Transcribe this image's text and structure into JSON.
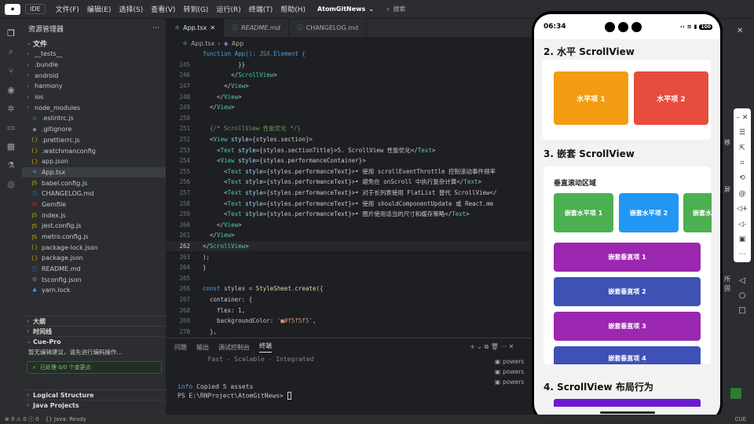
{
  "titlebar": {
    "ide": "IDE",
    "menus": [
      "文件(F)",
      "编辑(E)",
      "选择(S)",
      "查看(V)",
      "转到(G)",
      "运行(R)",
      "终端(T)",
      "帮助(H)"
    ],
    "project": "AtomGitNews",
    "search": "搜索"
  },
  "explorer": {
    "title": "资源管理器",
    "root": "文件",
    "items": [
      {
        "name": "__tests__",
        "type": "folder"
      },
      {
        "name": ".bundle",
        "type": "folder"
      },
      {
        "name": "android",
        "type": "folder"
      },
      {
        "name": "harmony",
        "type": "folder"
      },
      {
        "name": "ios",
        "type": "folder"
      },
      {
        "name": "node_modules",
        "type": "folder"
      },
      {
        "name": ".eslintrc.js",
        "type": "file",
        "icon": "⊙",
        "color": "#4b7bec"
      },
      {
        "name": ".gitignore",
        "type": "file",
        "icon": "◆",
        "color": "#888"
      },
      {
        "name": ".prettierrc.js",
        "type": "file",
        "icon": "{}",
        "color": "#c8a000"
      },
      {
        "name": ".watchmanconfig",
        "type": "file",
        "icon": "{}",
        "color": "#c8a000"
      },
      {
        "name": "app.json",
        "type": "file",
        "icon": "{}",
        "color": "#c8a000"
      },
      {
        "name": "App.tsx",
        "type": "file",
        "icon": "⚛",
        "color": "#5fb0e0",
        "sel": true
      },
      {
        "name": "babel.config.js",
        "type": "file",
        "icon": "JS",
        "color": "#c8b000"
      },
      {
        "name": "CHANGELOG.md",
        "type": "file",
        "icon": "ⓘ",
        "color": "#4b9bec"
      },
      {
        "name": "Gemfile",
        "type": "file",
        "icon": "▤",
        "color": "#aa3333"
      },
      {
        "name": "index.js",
        "type": "file",
        "icon": "JS",
        "color": "#c8b000"
      },
      {
        "name": "jest.config.js",
        "type": "file",
        "icon": "JS",
        "color": "#c8b000"
      },
      {
        "name": "metro.config.js",
        "type": "file",
        "icon": "JS",
        "color": "#c8b000"
      },
      {
        "name": "package-lock.json",
        "type": "file",
        "icon": "{}",
        "color": "#c8a000"
      },
      {
        "name": "package.json",
        "type": "file",
        "icon": "{}",
        "color": "#c8a000"
      },
      {
        "name": "README.md",
        "type": "file",
        "icon": "ⓘ",
        "color": "#4b9bec"
      },
      {
        "name": "tsconfig.json",
        "type": "file",
        "icon": "⚙",
        "color": "#888"
      },
      {
        "name": "yarn.lock",
        "type": "file",
        "icon": "♣",
        "color": "#4b9bec"
      }
    ],
    "sections": [
      "大纲",
      "时间线"
    ],
    "cue": {
      "title": "Cue-Pro",
      "msg": "暂无编辑建议，请先进行编码操作...",
      "status": "已处理 0/0 个变更点"
    },
    "bottom": [
      "Logical Structure",
      "Java Projects"
    ]
  },
  "editor": {
    "tabs": [
      {
        "label": "App.tsx",
        "active": true
      },
      {
        "label": "README.md",
        "italic": true
      },
      {
        "label": "CHANGELOG.md"
      }
    ],
    "breadcrumb": [
      "App.tsx",
      "App"
    ],
    "signature": "function App(): JSX.Element {",
    "lines": [
      {
        "n": "245",
        "t": "          }}"
      },
      {
        "n": "246",
        "t": "        </ScrollView>"
      },
      {
        "n": "247",
        "t": "      </View>"
      },
      {
        "n": "248",
        "t": "    </View>"
      },
      {
        "n": "249",
        "t": "  </View>"
      },
      {
        "n": "250",
        "t": ""
      },
      {
        "n": "251",
        "t": "  {/* ScrollView 性能优化 */}"
      },
      {
        "n": "252",
        "t": "  <View style={styles.section}>"
      },
      {
        "n": "253",
        "t": "    <Text style={styles.sectionTitle}>5. ScrollView 性能优化</Text>"
      },
      {
        "n": "254",
        "t": "    <View style={styles.performanceContainer}>"
      },
      {
        "n": "255",
        "t": "      <Text style={styles.performanceText}>• 使用 scrollEventThrottle 控制滚动事件频率"
      },
      {
        "n": "256",
        "t": "      <Text style={styles.performanceText}>• 避免在 onScroll 中执行复杂计算</Text>"
      },
      {
        "n": "257",
        "t": "      <Text style={styles.performanceText}>• 对于长列表使用 FlatList 替代 ScrollView</"
      },
      {
        "n": "258",
        "t": "      <Text style={styles.performanceText}>• 使用 shouldComponentUpdate 或 React.me"
      },
      {
        "n": "259",
        "t": "      <Text style={styles.performanceText}>• 图片使用适当的尺寸和缓存策略</Text>"
      },
      {
        "n": "260",
        "t": "    </View>"
      },
      {
        "n": "261",
        "t": "  </View>"
      },
      {
        "n": "262",
        "t": "</ScrollView>",
        "cur": true
      },
      {
        "n": "263",
        "t": ");"
      },
      {
        "n": "264",
        "t": "}"
      },
      {
        "n": "265",
        "t": ""
      },
      {
        "n": "266",
        "t": "const styles = StyleSheet.create({"
      },
      {
        "n": "267",
        "t": "  container: {"
      },
      {
        "n": "268",
        "t": "    flex: 1,"
      },
      {
        "n": "269",
        "t": "    backgroundColor: '■#f5f5f5',"
      },
      {
        "n": "270",
        "t": "  },"
      }
    ]
  },
  "panel": {
    "tabs": [
      "问题",
      "输出",
      "调试控制台",
      "终端"
    ],
    "active": "终端",
    "lines": [
      "        Fast - Scalable - Integrated",
      "",
      "",
      "info Copied 5 assets",
      "PS E:\\RNProject\\AtomGitNews> "
    ],
    "terms": [
      "powers",
      "powers",
      "powers"
    ]
  },
  "phone": {
    "time": "06:34",
    "battery": "100",
    "s2": "2. 水平 ScrollView",
    "h1": "水平项 1",
    "h2": "水平项 2",
    "s3": "3. 嵌套 ScrollView",
    "nestTitle": "垂直滚动区域",
    "nh": [
      "嵌套水平项 1",
      "嵌套水平项 2",
      "嵌套水"
    ],
    "nv": [
      "嵌套垂直项 1",
      "嵌套垂直项 2",
      "嵌套垂直项 3",
      "嵌套垂直项 4"
    ],
    "s4": "4. ScrollView 布局行为"
  },
  "rightpeek": [
    "移",
    "屏",
    "所",
    "固"
  ],
  "status": {
    "errors": "0",
    "warnings": "0",
    "info": "0",
    "java": "Java: Ready",
    "enc": "CUE"
  }
}
